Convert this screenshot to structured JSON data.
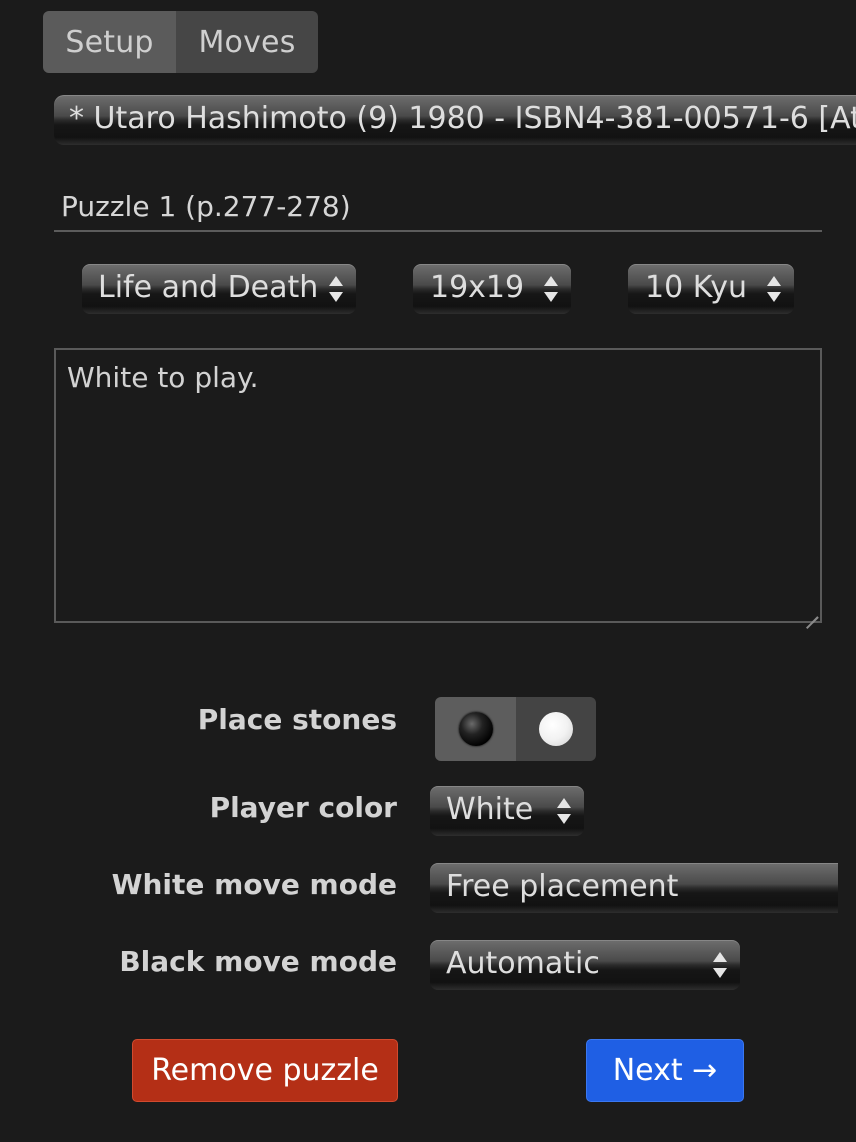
{
  "tabs": [
    {
      "label": "Setup",
      "active": true
    },
    {
      "label": "Moves",
      "active": false
    }
  ],
  "collection_select": {
    "value": "* Utaro Hashimoto (9) 1980 - ISBN4-381-00571-6 [At"
  },
  "puzzle_title": {
    "value": "Puzzle 1 (p.277-278)"
  },
  "type_select": {
    "value": "Life and Death"
  },
  "size_select": {
    "value": "19x19"
  },
  "rank_select": {
    "value": "10 Kyu"
  },
  "description": {
    "value": "White to play."
  },
  "place_stones": {
    "label": "Place stones",
    "options": [
      "black-stone-icon",
      "white-stone-icon"
    ],
    "selected": "black-stone-icon"
  },
  "player_color": {
    "label": "Player color",
    "value": "White"
  },
  "white_move_mode": {
    "label": "White move mode",
    "value": "Free placement"
  },
  "black_move_mode": {
    "label": "Black move mode",
    "value": "Automatic"
  },
  "buttons": {
    "remove": "Remove puzzle",
    "next": "Next →"
  },
  "colors": {
    "background": "#1b1b1b",
    "remove": "#b42f16",
    "next": "#1f5fe4"
  }
}
